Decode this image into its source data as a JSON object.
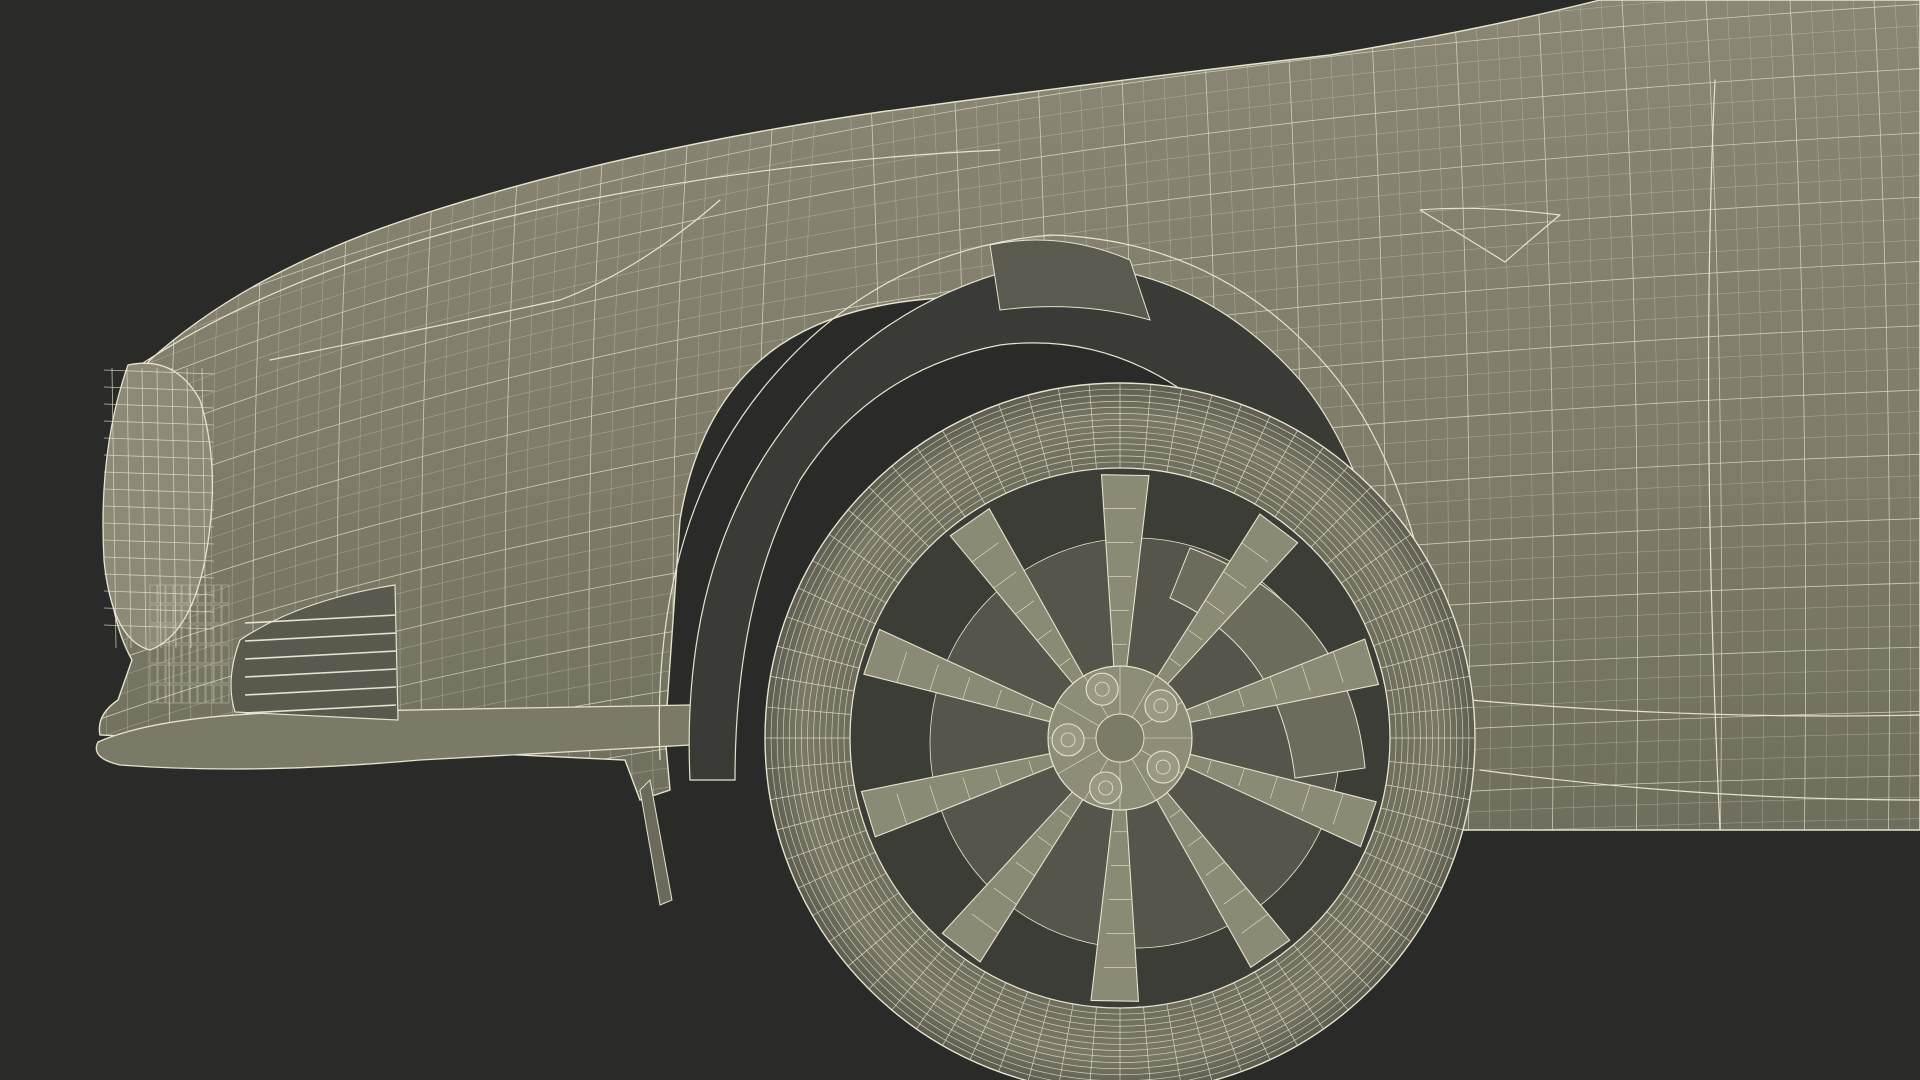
{
  "scene": {
    "subject": "",
    "colors": {
      "background": "#2a2a29",
      "body": "#82806c",
      "body_shadow": "#66655a",
      "wheel_well": "#3b3b37",
      "tire": "#73725f",
      "rim": "#8b8a75",
      "wire": "#e6e4cf"
    },
    "wheel": {
      "spoke_count": 10,
      "lug_nut_count": 5
    },
    "mesh": {
      "body_grid_rows": 14,
      "tire_rings": 14,
      "tire_segments": 72
    }
  }
}
